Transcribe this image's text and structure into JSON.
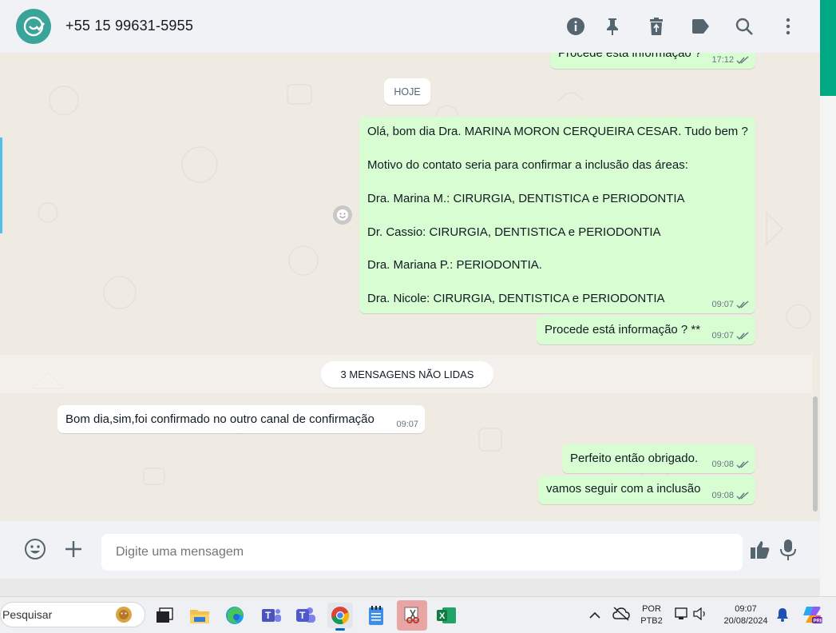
{
  "header": {
    "contact_name": "+55 15 99631-5955",
    "icons": [
      "info-icon",
      "pin-icon",
      "delete-icon",
      "label-icon",
      "search-icon",
      "menu-icon"
    ]
  },
  "chat": {
    "prev_message": {
      "text": "Procede está informação ?",
      "time": "17:12"
    },
    "date_chip": "HOJE",
    "long_message": {
      "lines": [
        "Olá, bom dia  Dra. MARINA MORON CERQUEIRA CESAR. Tudo bem ?",
        "Motivo do contato seria para confirmar a inclusão das áreas:",
        "Dra. Marina M.: CIRURGIA, DENTISTICA e PERIODONTIA",
        "Dr. Cassio: CIRURGIA, DENTISTICA e PERIODONTIA",
        "Dra. Mariana P.: PERIODONTIA.",
        "Dra. Nicole: CIRURGIA, DENTISTICA e PERIODONTIA"
      ],
      "time": "09:07"
    },
    "msg_procede": {
      "text": "Procede está informação ? **",
      "time": "09:07"
    },
    "unread_label": "3 MENSAGENS NÃO LIDAS",
    "msg_in": {
      "text": "Bom dia,sim,foi confirmado no outro canal de confirmação",
      "time": "09:07"
    },
    "msg_perfeito": {
      "text": "Perfeito então obrigado.",
      "time": "09:08"
    },
    "msg_vamos": {
      "text": "vamos seguir com a inclusão",
      "time": "09:08"
    }
  },
  "composer": {
    "placeholder": "Digite uma mensagem"
  },
  "taskbar": {
    "search_placeholder": "Pesquisar",
    "lang_line1": "POR",
    "lang_line2": "PTB2",
    "clock_time": "09:07",
    "clock_date": "20/08/2024"
  },
  "colors": {
    "accent": "#00a884",
    "outgoing": "#d9fdd3",
    "incoming": "#ffffff",
    "read_ticks": "#53bdeb",
    "avatar": "#3aa39a"
  }
}
